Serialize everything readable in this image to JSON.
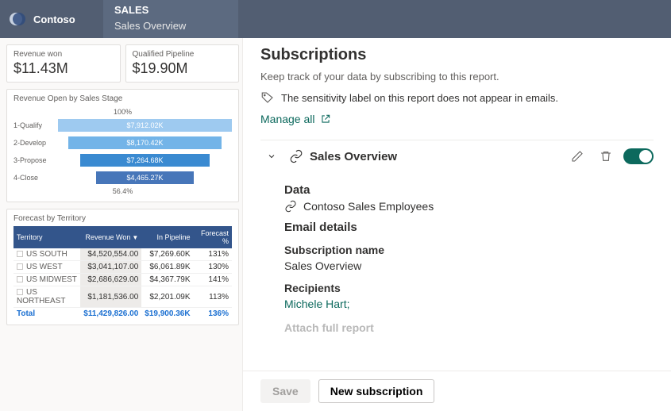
{
  "brand": {
    "name": "Contoso"
  },
  "nav": {
    "section": "SALES",
    "page": "Sales Overview"
  },
  "kpis": {
    "revenue_won": {
      "label": "Revenue won",
      "value": "$11.43M"
    },
    "qualified_pipeline": {
      "label": "Qualified Pipeline",
      "value": "$19.90M"
    }
  },
  "stage_chart": {
    "title": "Revenue Open by Sales Stage",
    "top_pct": "100%",
    "bottom_pct": "56.4%",
    "rows": [
      {
        "label": "1-Qualify",
        "value": "$7,912.02K"
      },
      {
        "label": "2-Develop",
        "value": "$8,170.42K"
      },
      {
        "label": "3-Propose",
        "value": "$7,264.68K"
      },
      {
        "label": "4-Close",
        "value": "$4,465.27K"
      }
    ]
  },
  "forecast": {
    "title": "Forecast by Territory",
    "headers": {
      "territory": "Territory",
      "revenue_won": "Revenue Won",
      "in_pipeline": "In Pipeline",
      "forecast_pct": "Forecast %"
    },
    "rows": [
      {
        "territory": "US SOUTH",
        "revenue_won": "$4,520,554.00",
        "in_pipeline": "$7,269.60K",
        "forecast_pct": "131%"
      },
      {
        "territory": "US WEST",
        "revenue_won": "$3,041,107.00",
        "in_pipeline": "$6,061.89K",
        "forecast_pct": "130%"
      },
      {
        "territory": "US MIDWEST",
        "revenue_won": "$2,686,629.00",
        "in_pipeline": "$4,367.79K",
        "forecast_pct": "141%"
      },
      {
        "territory": "US NORTHEAST",
        "revenue_won": "$1,181,536.00",
        "in_pipeline": "$2,201.09K",
        "forecast_pct": "113%"
      }
    ],
    "total": {
      "label": "Total",
      "revenue_won": "$11,429,826.00",
      "in_pipeline": "$19,900.36K",
      "forecast_pct": "136%"
    }
  },
  "panel": {
    "title": "Subscriptions",
    "desc": "Keep track of your data by subscribing to this report.",
    "sensitivity_note": "The sensitivity label on this report does not appear in emails.",
    "manage_all": "Manage all",
    "subscription": {
      "name": "Sales Overview",
      "data_section": "Data",
      "data_value": "Contoso Sales Employees",
      "email_section": "Email details",
      "sub_name_label": "Subscription name",
      "sub_name_value": "Sales Overview",
      "recipients_label": "Recipients",
      "recipients_value": "Michele Hart;",
      "attach_label": "Attach full report"
    },
    "buttons": {
      "save": "Save",
      "new": "New subscription"
    }
  },
  "chart_data": {
    "type": "bar",
    "title": "Revenue Open by Sales Stage",
    "categories": [
      "1-Qualify",
      "2-Develop",
      "3-Propose",
      "4-Close"
    ],
    "values": [
      7912.02,
      8170.42,
      7264.68,
      4465.27
    ],
    "unit": "K USD",
    "funnel_top_pct": 100,
    "funnel_bottom_pct": 56.4
  }
}
